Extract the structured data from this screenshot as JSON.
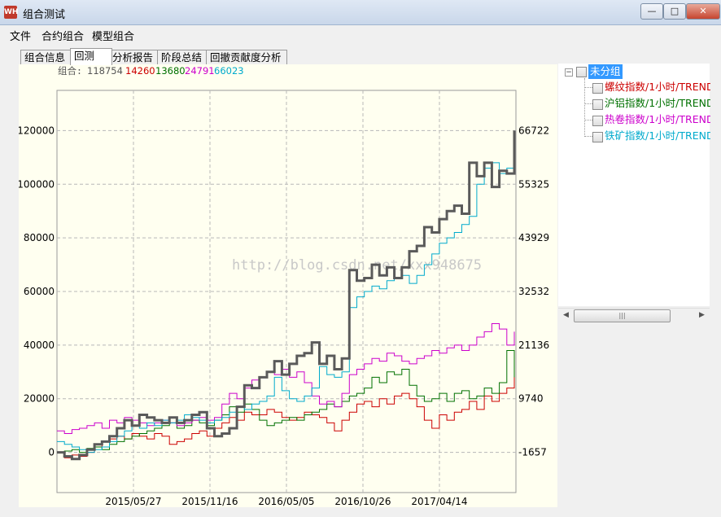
{
  "window": {
    "title": "组合测试",
    "icon_text": "WH",
    "min": "—",
    "max": "□",
    "close": "✕"
  },
  "menu": {
    "items": [
      "文件",
      "合约组合",
      "模型组合"
    ]
  },
  "tabs": [
    {
      "label": "组合信息",
      "active": false
    },
    {
      "label": "回测",
      "active": true
    },
    {
      "label": "分析报告",
      "active": false
    },
    {
      "label": "阶段总结",
      "active": false
    },
    {
      "label": "回撤贡献度分析",
      "active": false
    }
  ],
  "legend": {
    "label": "组合:",
    "items": [
      {
        "value": "118754",
        "color": "#555555"
      },
      {
        "value": "14260",
        "color": "#cc0000"
      },
      {
        "value": "13680",
        "color": "#007000"
      },
      {
        "value": "24791",
        "color": "#cc00cc"
      },
      {
        "value": "66023",
        "color": "#00aacc"
      }
    ]
  },
  "watermark": "http://blog.csdn.net/xxx948675",
  "tree": {
    "root": {
      "label": "未分组",
      "expander": "−"
    },
    "children": [
      {
        "label": "螺纹指数/1小时/TREND",
        "color": "#cc0000"
      },
      {
        "label": "沪铝指数/1小时/TREND",
        "color": "#007000"
      },
      {
        "label": "热卷指数/1小时/TREND",
        "color": "#cc00cc"
      },
      {
        "label": "铁矿指数/1小时/TREND",
        "color": "#00aacc"
      }
    ]
  },
  "scrollbar": {
    "left": "◀",
    "right": "▶",
    "grip": "|||"
  },
  "chart_data": {
    "type": "line",
    "x_ticks": [
      "2015/05/27",
      "2015/11/16",
      "2016/05/05",
      "2016/10/26",
      "2017/04/14"
    ],
    "left_axis": {
      "ticks": [
        "120000",
        "100000",
        "80000",
        "60000",
        "40000",
        "20000",
        "0"
      ],
      "ylim": [
        -15000,
        135000
      ]
    },
    "right_axis": {
      "ticks": [
        "66722",
        "55325",
        "43929",
        "32532",
        "21136",
        "9740",
        "-1657"
      ]
    },
    "grid": true,
    "series": [
      {
        "name": "组合",
        "color": "#5a5a5a",
        "width": 3,
        "values": [
          0,
          -1500,
          -2500,
          -1000,
          1000,
          3000,
          4000,
          6000,
          9000,
          12000,
          10000,
          14000,
          13000,
          12000,
          11000,
          13000,
          11000,
          12000,
          14000,
          15000,
          9000,
          6000,
          7000,
          9000,
          17000,
          25000,
          24000,
          28000,
          30000,
          34000,
          29000,
          33000,
          36000,
          37000,
          41000,
          33000,
          36000,
          31000,
          35000,
          68000,
          64000,
          65000,
          70000,
          66000,
          69000,
          65000,
          69000,
          75000,
          77000,
          84000,
          82000,
          87000,
          90000,
          92000,
          89000,
          108000,
          103000,
          108000,
          99000,
          105000,
          104000,
          120000
        ]
      },
      {
        "name": "螺纹",
        "color": "#cc0000",
        "width": 1,
        "values": [
          0,
          -2000,
          -1000,
          -1500,
          0,
          2000,
          4000,
          5000,
          6000,
          5000,
          7000,
          6000,
          5000,
          7000,
          6000,
          3000,
          4000,
          5000,
          7000,
          8000,
          6000,
          9000,
          11000,
          13000,
          12000,
          15000,
          14000,
          14000,
          16000,
          15000,
          13000,
          12000,
          13000,
          15000,
          14000,
          13000,
          11000,
          8000,
          12000,
          15000,
          18000,
          19000,
          17000,
          20000,
          18000,
          21000,
          22000,
          20000,
          17000,
          12000,
          9000,
          14000,
          12000,
          15000,
          16000,
          19000,
          16000,
          21000,
          19000,
          22000,
          24000,
          29000
        ]
      },
      {
        "name": "沪铝",
        "color": "#007000",
        "width": 1,
        "values": [
          0,
          500,
          1000,
          0,
          1500,
          2000,
          1000,
          3000,
          4000,
          5000,
          6000,
          7000,
          8000,
          9000,
          10000,
          11000,
          9000,
          10000,
          12000,
          11000,
          10000,
          12000,
          14000,
          17000,
          15000,
          18000,
          16000,
          12000,
          10000,
          11000,
          12000,
          13000,
          12000,
          14000,
          15000,
          16000,
          18000,
          17000,
          19000,
          21000,
          22000,
          24000,
          28000,
          26000,
          30000,
          29000,
          31000,
          25000,
          21000,
          19000,
          20000,
          22000,
          19000,
          22000,
          23000,
          20000,
          21000,
          24000,
          22000,
          26000,
          38000,
          28000
        ]
      },
      {
        "name": "热卷",
        "color": "#cc00cc",
        "width": 1,
        "values": [
          8000,
          7000,
          8500,
          9000,
          10000,
          11000,
          9000,
          12000,
          11000,
          13000,
          12000,
          11000,
          10000,
          11000,
          12000,
          11000,
          10000,
          11000,
          12000,
          13000,
          12000,
          13000,
          18000,
          22000,
          20000,
          24000,
          27000,
          28000,
          30000,
          29000,
          31000,
          28000,
          30000,
          26000,
          21000,
          18000,
          19000,
          17000,
          22000,
          29000,
          31000,
          33000,
          35000,
          34000,
          37000,
          36000,
          34000,
          33000,
          35000,
          36000,
          38000,
          37000,
          39000,
          40000,
          38000,
          40000,
          43000,
          45000,
          48000,
          46000,
          40000,
          45000
        ]
      },
      {
        "name": "铁矿",
        "color": "#00aacc",
        "width": 1,
        "values": [
          4000,
          3000,
          2000,
          1000,
          0,
          1000,
          2000,
          4000,
          6000,
          8000,
          10000,
          9000,
          11000,
          10000,
          12000,
          11000,
          12000,
          14000,
          13000,
          12000,
          11000,
          12000,
          13000,
          15000,
          17000,
          16000,
          18000,
          19000,
          21000,
          28000,
          23000,
          20000,
          19000,
          21000,
          24000,
          32000,
          29000,
          28000,
          30000,
          54000,
          58000,
          60000,
          62000,
          61000,
          64000,
          65000,
          66000,
          63000,
          66000,
          70000,
          74000,
          78000,
          80000,
          82000,
          85000,
          88000,
          100000,
          106000,
          108000,
          104000,
          106000,
          109000
        ]
      }
    ]
  }
}
